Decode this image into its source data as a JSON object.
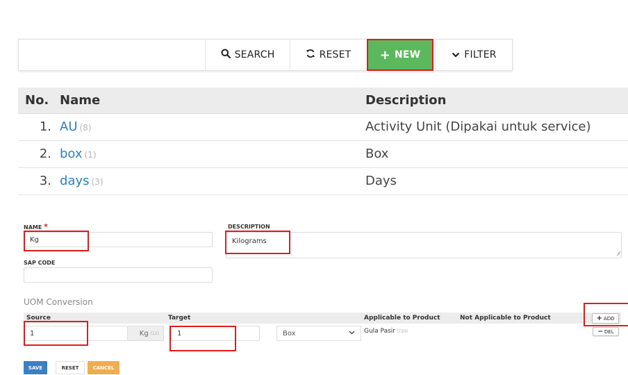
{
  "toolbar": {
    "search_label": "SEARCH",
    "reset_label": "RESET",
    "new_label": "NEW",
    "filter_label": "FILTER",
    "new_color": "#5cb85c"
  },
  "table": {
    "headers": {
      "no": "No.",
      "name": "Name",
      "description": "Description"
    },
    "rows": [
      {
        "no": "1.",
        "name": "AU",
        "count": "(8)",
        "description": "Activity Unit (Dipakai untuk service)"
      },
      {
        "no": "2.",
        "name": "box",
        "count": "(1)",
        "description": "Box"
      },
      {
        "no": "3.",
        "name": "days",
        "count": "(3)",
        "description": "Days"
      }
    ]
  },
  "form": {
    "name_label": "NAME",
    "required_mark": "*",
    "name_value": "Kg",
    "description_label": "DESCRIPTION",
    "description_value": "Kilograms",
    "sap_label": "SAP CODE",
    "sap_value": ""
  },
  "conversion": {
    "title": "UOM Conversion",
    "headers": {
      "source": "Source",
      "target": "Target",
      "applicable": "Applicable to Product",
      "not_applicable": "Not Applicable to Product"
    },
    "add_label": "ADD",
    "row": {
      "source_value": "1",
      "source_unit": "Kg",
      "source_unit_count": "(12)",
      "target_value": "1",
      "target_unit": "Box",
      "product": "Gula Pasir",
      "product_count": "(720)",
      "del_label": "DEL"
    }
  },
  "footer": {
    "save_label": "SAVE",
    "reset_label": "RESET",
    "cancel_label": "CANCEL",
    "save_color": "#3b7fc4",
    "cancel_color": "#f0ad4e"
  },
  "highlight_color": "#e01a1a"
}
